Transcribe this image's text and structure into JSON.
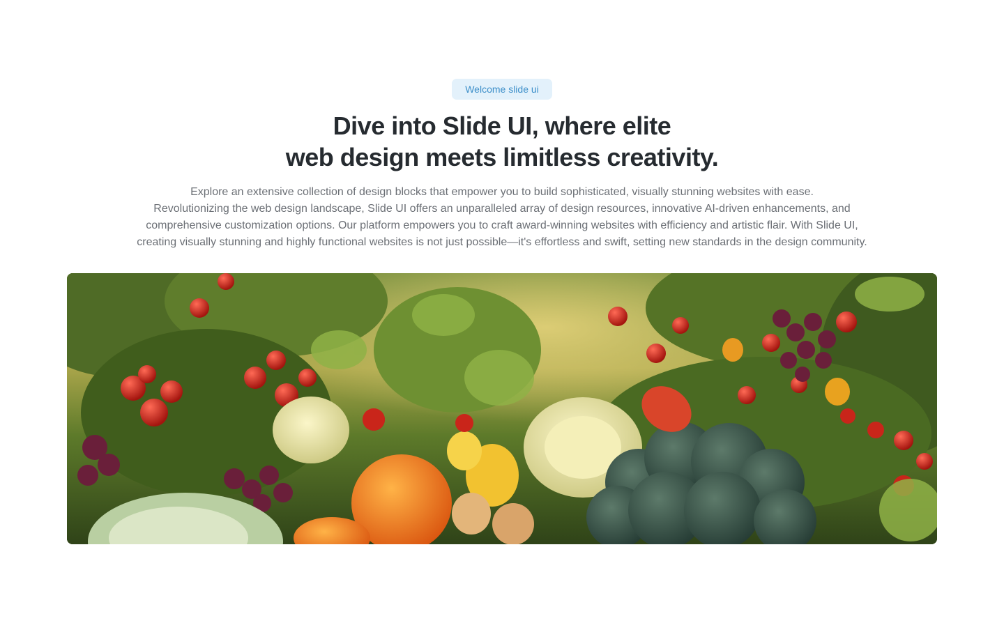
{
  "badge": {
    "label": "Welcome slide ui"
  },
  "headline": {
    "line1": "Dive into Slide UI, where elite",
    "line2": "web design meets limitless creativity."
  },
  "description": {
    "lines": [
      "Explore an extensive collection of design blocks that empower you to build sophisticated, visually stunning websites with ease.",
      "Revolutionizing the web design landscape, Slide UI offers an unparalleled array of design resources, innovative AI-driven enhancements, and",
      "comprehensive customization options. Our platform empowers you to craft award-winning websites with efficiency and artistic flair. With Slide UI,",
      "creating visually stunning and highly functional websites is not just possible—it's effortless and swift, setting new standards in the design community."
    ]
  },
  "colors": {
    "badge_bg": "#e3f1fb",
    "badge_text": "#3d8fc9",
    "headline": "#262b30",
    "body_text": "#6b6f75"
  }
}
